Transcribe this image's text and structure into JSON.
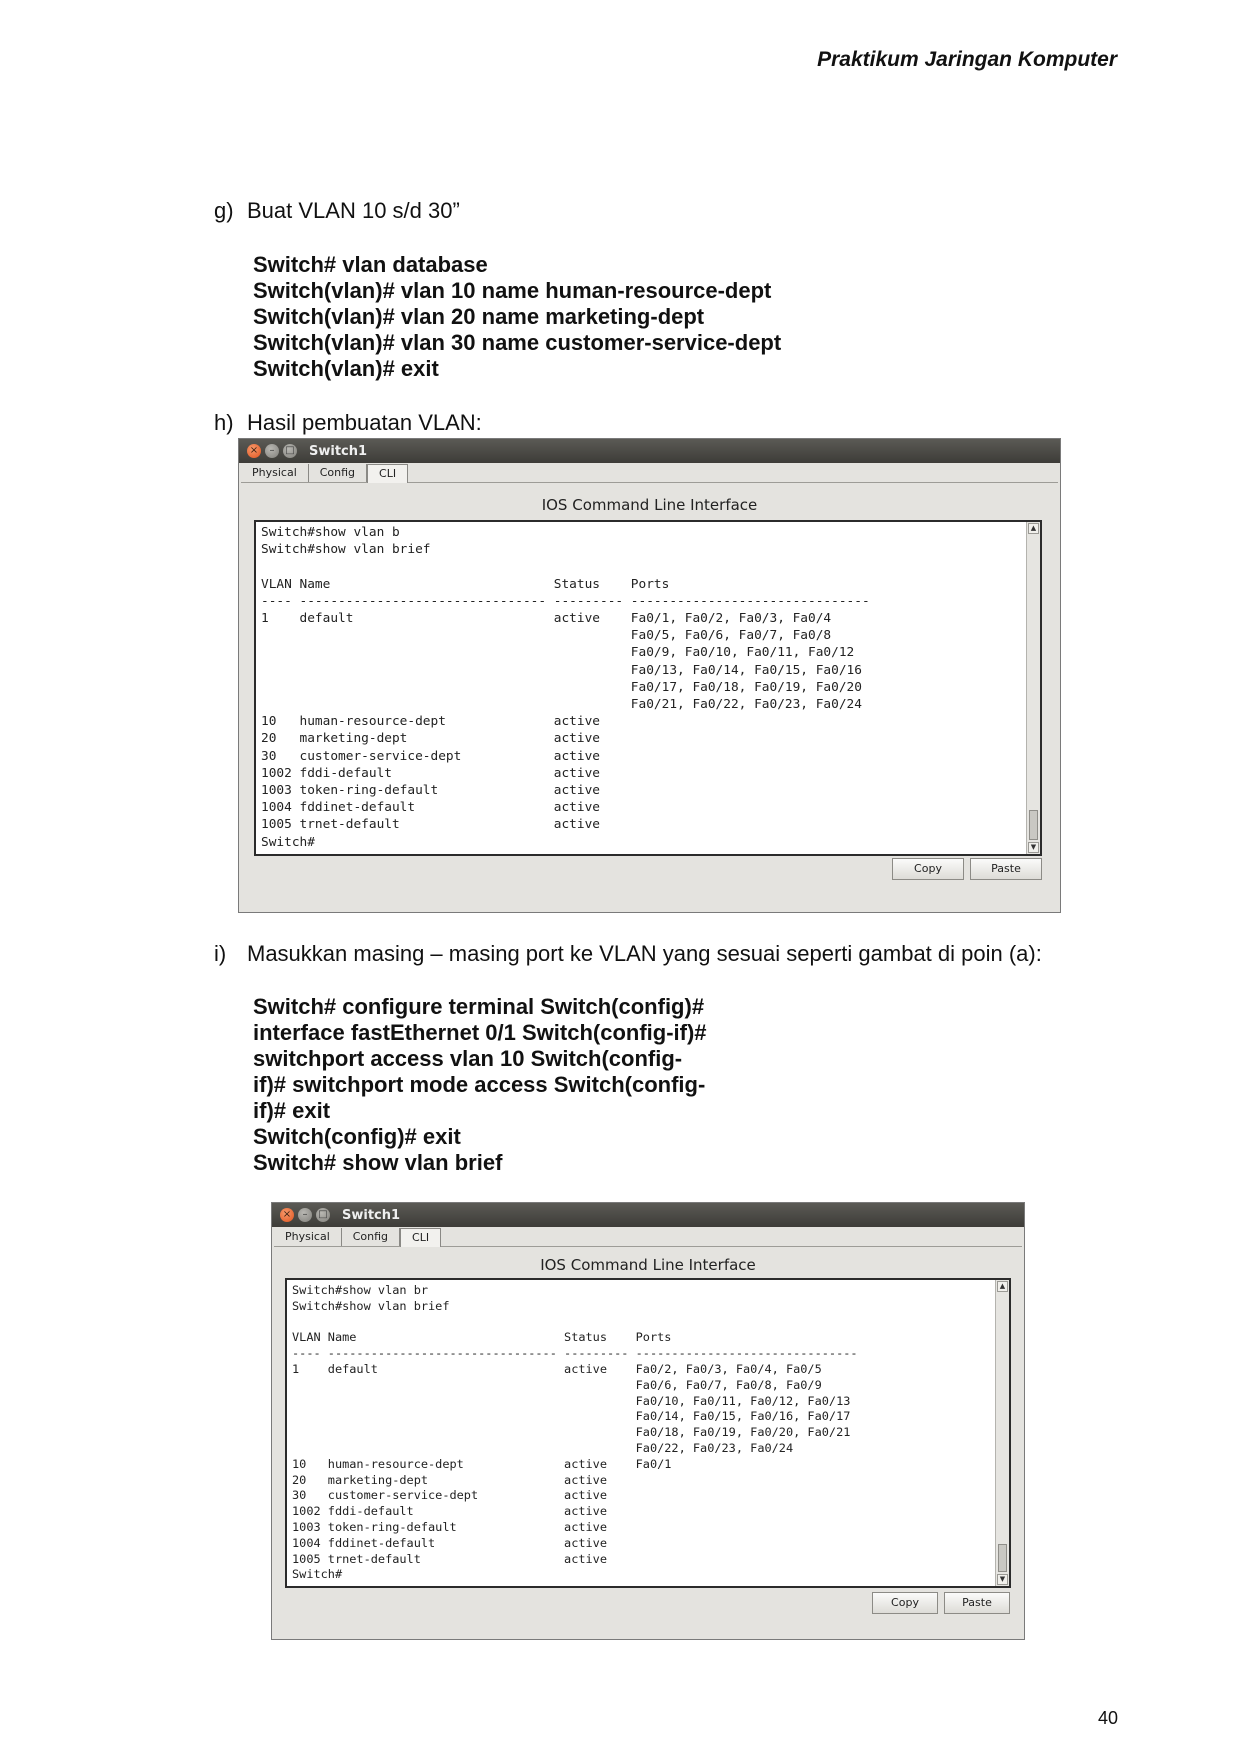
{
  "header": {
    "course_title": "Praktikum Jaringan Komputer"
  },
  "steps": {
    "g": {
      "letter": "g)",
      "title": "Buat VLAN 10 s/d 30”",
      "commands": [
        "Switch# vlan database",
        "Switch(vlan)# vlan 10 name human-resource-dept",
        "Switch(vlan)# vlan 20 name marketing-dept",
        "Switch(vlan)# vlan 30 name customer-service-dept",
        "Switch(vlan)# exit"
      ]
    },
    "h": {
      "letter": "h)",
      "title": "Hasil pembuatan VLAN:"
    },
    "i": {
      "letter": "i)",
      "title": "Masukkan masing – masing port ke VLAN yang sesuai seperti gambat di poin (a):",
      "commands": [
        "Switch# configure terminal Switch(config)#",
        "interface fastEthernet 0/1 Switch(config-if)#",
        "switchport access vlan 10 Switch(config-",
        "if)# switchport mode access Switch(config-",
        "if)# exit",
        "Switch(config)# exit",
        "Switch# show vlan brief"
      ]
    }
  },
  "window1": {
    "title": "Switch1",
    "tabs": [
      "Physical",
      "Config",
      "CLI"
    ],
    "active_tab": "CLI",
    "cli_heading": "IOS Command Line Interface",
    "copy_label": "Copy",
    "paste_label": "Paste",
    "terminal_text": "Switch#show vlan b\nSwitch#show vlan brief\n\nVLAN Name                             Status    Ports\n---- -------------------------------- --------- -------------------------------\n1    default                          active    Fa0/1, Fa0/2, Fa0/3, Fa0/4\n                                                Fa0/5, Fa0/6, Fa0/7, Fa0/8\n                                                Fa0/9, Fa0/10, Fa0/11, Fa0/12\n                                                Fa0/13, Fa0/14, Fa0/15, Fa0/16\n                                                Fa0/17, Fa0/18, Fa0/19, Fa0/20\n                                                Fa0/21, Fa0/22, Fa0/23, Fa0/24\n10   human-resource-dept              active\n20   marketing-dept                   active\n30   customer-service-dept            active\n1002 fddi-default                     active\n1003 token-ring-default               active\n1004 fddinet-default                  active\n1005 trnet-default                    active\nSwitch#"
  },
  "window2": {
    "title": "Switch1",
    "tabs": [
      "Physical",
      "Config",
      "CLI"
    ],
    "active_tab": "CLI",
    "cli_heading": "IOS Command Line Interface",
    "copy_label": "Copy",
    "paste_label": "Paste",
    "terminal_text": "Switch#show vlan br\nSwitch#show vlan brief\n\nVLAN Name                             Status    Ports\n---- -------------------------------- --------- -------------------------------\n1    default                          active    Fa0/2, Fa0/3, Fa0/4, Fa0/5\n                                                Fa0/6, Fa0/7, Fa0/8, Fa0/9\n                                                Fa0/10, Fa0/11, Fa0/12, Fa0/13\n                                                Fa0/14, Fa0/15, Fa0/16, Fa0/17\n                                                Fa0/18, Fa0/19, Fa0/20, Fa0/21\n                                                Fa0/22, Fa0/23, Fa0/24\n10   human-resource-dept              active    Fa0/1\n20   marketing-dept                   active\n30   customer-service-dept            active\n1002 fddi-default                     active\n1003 token-ring-default               active\n1004 fddinet-default                  active\n1005 trnet-default                    active\nSwitch#"
  },
  "footer": {
    "page_number": "40"
  }
}
